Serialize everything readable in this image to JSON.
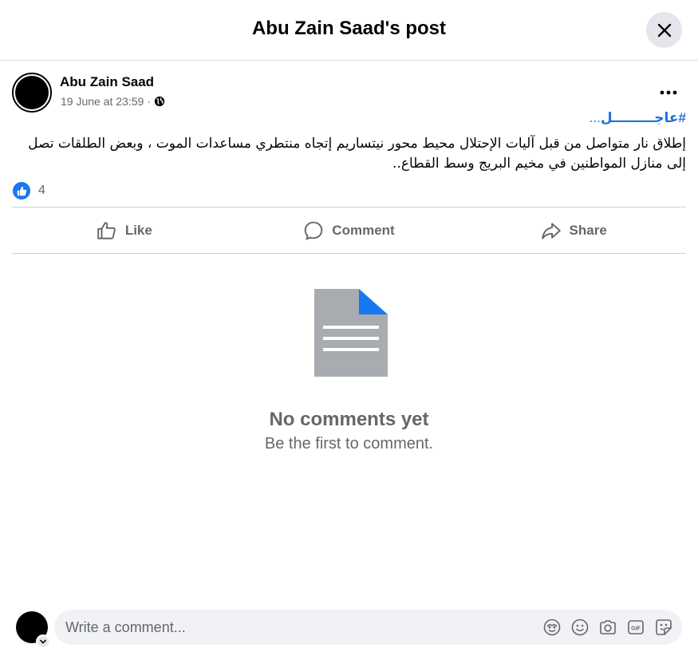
{
  "header": {
    "title": "Abu Zain Saad's post"
  },
  "post": {
    "author": "Abu Zain Saad",
    "timestamp": "19 June at 23:59",
    "separator": "·",
    "hashtag": "#عاجـــــــــل",
    "hashtag_suffix": "...",
    "text": "إطلاق نار متواصل من قبل آليات الإحتلال محيط محور نيتساريم إتجاه منتطري مساعدات الموت ، وبعض الطلقات تصل إلى منازل المواطنين في مخيم البريج وسط القطاع..",
    "reaction_count": "4"
  },
  "actions": {
    "like": "Like",
    "comment": "Comment",
    "share": "Share"
  },
  "empty_state": {
    "title": "No comments yet",
    "subtitle": "Be the first to comment."
  },
  "composer": {
    "placeholder": "Write a comment..."
  },
  "colors": {
    "accent": "#1877f2",
    "secondary_text": "#65676b",
    "hashtag": "#216fdb"
  }
}
